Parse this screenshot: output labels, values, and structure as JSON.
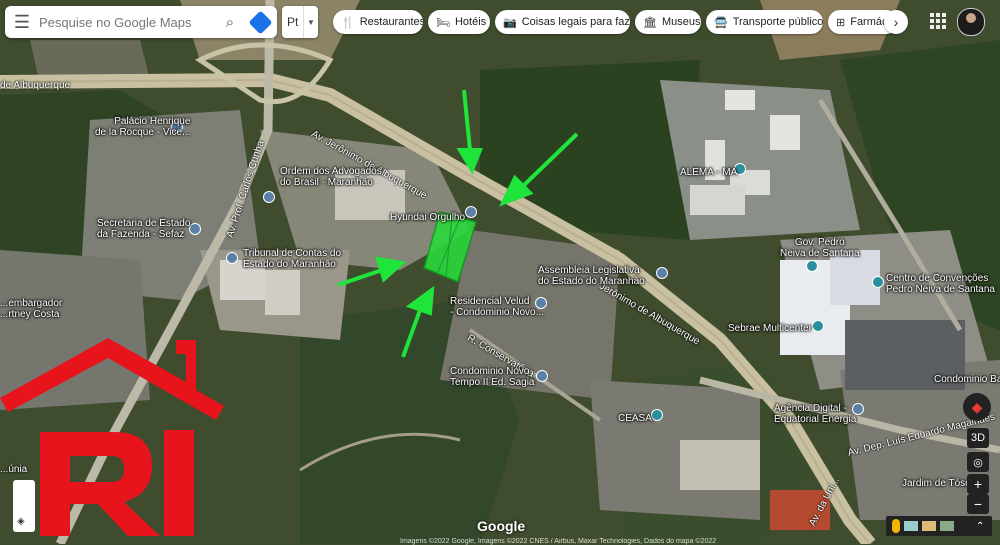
{
  "search": {
    "placeholder": "Pesquise no Google Maps",
    "menu_icon": "menu-icon",
    "search_icon": "search-icon",
    "directions_icon": "directions-icon"
  },
  "language": {
    "value": "Pt"
  },
  "chips": [
    {
      "icon": "fork-knife-icon",
      "glyph": "🍴",
      "label": "Restaurantes"
    },
    {
      "icon": "bed-icon",
      "glyph": "🛏",
      "label": "Hotéis"
    },
    {
      "icon": "camera-icon",
      "glyph": "📷",
      "label": "Coisas legais para fazer"
    },
    {
      "icon": "museum-icon",
      "glyph": "🏛",
      "label": "Museus"
    },
    {
      "icon": "bus-icon",
      "glyph": "🚍",
      "label": "Transporte público"
    },
    {
      "icon": "pharmacy-icon",
      "glyph": "⊞",
      "label": "Farmácias"
    }
  ],
  "chip_next": "›",
  "places": {
    "albuquerque_west": "de Albuquerque",
    "av_jeronimo_north": "Av. Jerônimo de Albuquerque",
    "palacio": [
      "Palácio Henrique",
      "de la Rocque - Vice..."
    ],
    "ordem": [
      "Ordem dos Advogados",
      "do Brasil - Maranhão"
    ],
    "secretaria": [
      "Secretaria de Estado",
      "da Fazenda - Sefaz"
    ],
    "tribunal": [
      "Tribunal de Contas do",
      "Estado do Maranhão"
    ],
    "hyundai": "Hyundai Orgulho",
    "alema": "ALEMA - MA",
    "gov": [
      "Gov. Pedro",
      "Neiva de Santana"
    ],
    "assembleia": [
      "Assembleia Legislativa",
      "do Estado do Maranhão"
    ],
    "centro": [
      "Centro de Convenções",
      "Pedro Neiva de Santana"
    ],
    "velud": [
      "Residencial Velud",
      "- Condominio Novo..."
    ],
    "sebrae": "Sebrae Multicenter",
    "condominio_tempo": [
      "Condominio Novo",
      "Tempo II Ed. Sagia"
    ],
    "ceasa": "CEASA",
    "agencia": [
      "Agência Digital -",
      "Equatorial Energia"
    ],
    "jardim": "Jardim de Tóscana",
    "condominio_ba": "Condominio Ba...",
    "desembargador": [
      "...embargador",
      "...rtney Costa"
    ],
    "av_prof": "Av. Prof. Carlos Cunha",
    "r_conservatorio": "R. Conservatória",
    "jeronimo_south": "Jerônimo de Albuquerque",
    "av_dep": "Av. Dep. Luís Eduardo Magalhães",
    "av_uni": "Av. da Uni...",
    "unica": "...únia"
  },
  "controls": {
    "compass": "compass-icon",
    "view_3d": "3D",
    "location": "◎",
    "zoom_in": "+",
    "zoom_out": "−"
  },
  "brand": "Google",
  "footer": "Imagens ©2022 Google, Imagens ©2022 CNES / Airbus, Maxar Technologies, Dados do mapa ©2022",
  "overlay": {
    "logo": "RI",
    "arrow_color": "#22e03a",
    "logo_color": "#e8141c",
    "plot_color": "#22e03a"
  }
}
